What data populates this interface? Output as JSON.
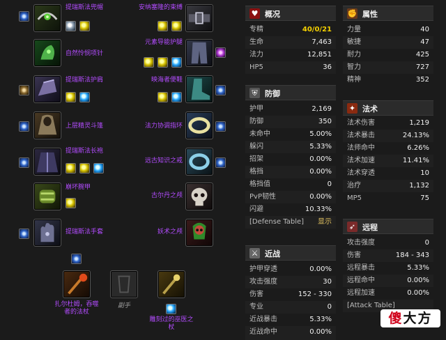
{
  "gear": {
    "head_name": "提瑞斯法兜帽",
    "neck_name": "自然怜悯项针",
    "shoulder_name": "提瑞斯法护肩",
    "back_name": "上层精灵斗篷",
    "chest_name": "提瑞斯法长袍",
    "wrist_name": "崩坏腕甲",
    "hands_name": "提瑞斯法手套",
    "waist_name": "安纳塞隆的束缚",
    "legs_name": "元素导能护腿",
    "feet_name": "映海者便鞋",
    "ring1_name": "法力协调指环",
    "ring2_name": "远古知识之戒",
    "trinket1_name": "古尔丹之颅",
    "trinket2_name": "妖术之颅",
    "mainhand_name": "扎尔杜姆，吞噬者的法杖",
    "offhand_name": "副手",
    "ranged_name": "雕刻过的巫医之杖"
  },
  "stats": {
    "overview": {
      "title": "概况",
      "rows": [
        {
          "label": "专精",
          "value": "40/0/21"
        },
        {
          "label": "生命",
          "value": "7,463"
        },
        {
          "label": "法力",
          "value": "12,851"
        },
        {
          "label": "HP5",
          "value": "36"
        }
      ]
    },
    "defense": {
      "title": "防御",
      "rows": [
        {
          "label": "护甲",
          "value": "2,169"
        },
        {
          "label": "防御",
          "value": "350"
        },
        {
          "label": "未命中",
          "value": "5.00%"
        },
        {
          "label": "躲闪",
          "value": "5.33%"
        },
        {
          "label": "招架",
          "value": "0.00%"
        },
        {
          "label": "格挡",
          "value": "0.00%"
        },
        {
          "label": "格挡值",
          "value": "0"
        },
        {
          "label": "PvP韧性",
          "value": "0.00%"
        },
        {
          "label": "闪避",
          "value": "10.33%"
        },
        {
          "label": "[Defense Table]",
          "value": "显示"
        }
      ]
    },
    "melee": {
      "title": "近战",
      "rows": [
        {
          "label": "护甲穿透",
          "value": "0.00%"
        },
        {
          "label": "攻击强度",
          "value": "30"
        },
        {
          "label": "伤害",
          "value": "152 - 330"
        },
        {
          "label": "专业",
          "value": "0"
        },
        {
          "label": "近战暴击",
          "value": "5.33%"
        },
        {
          "label": "近战命中",
          "value": "0.00%"
        }
      ]
    },
    "attributes": {
      "title": "属性",
      "rows": [
        {
          "label": "力量",
          "value": "40"
        },
        {
          "label": "敏捷",
          "value": "47"
        },
        {
          "label": "耐力",
          "value": "425"
        },
        {
          "label": "智力",
          "value": "727"
        },
        {
          "label": "精神",
          "value": "352"
        }
      ]
    },
    "spell": {
      "title": "法术",
      "rows": [
        {
          "label": "法术伤害",
          "value": "1,219"
        },
        {
          "label": "法术暴击",
          "value": "24.13%"
        },
        {
          "label": "法师命中",
          "value": "6.26%"
        },
        {
          "label": "法术加速",
          "value": "11.41%"
        },
        {
          "label": "法术穿透",
          "value": "10"
        },
        {
          "label": "治疗",
          "value": "1,132"
        },
        {
          "label": "MP5",
          "value": "75"
        }
      ]
    },
    "ranged": {
      "title": "远程",
      "rows": [
        {
          "label": "攻击强度",
          "value": "0"
        },
        {
          "label": "伤害",
          "value": "184 - 343"
        },
        {
          "label": "远程暴击",
          "value": "5.33%"
        },
        {
          "label": "远程命中",
          "value": "0.00%"
        },
        {
          "label": "远程加速",
          "value": "0.00%"
        },
        {
          "label": "[Attack Table]",
          "value": ""
        }
      ]
    }
  },
  "watermark": {
    "part1": "傻",
    "part2": "大方"
  },
  "colors": {
    "item_epic": "#b34cff",
    "spec_highlight": "#f4d000",
    "background": "#1b1b1b"
  }
}
